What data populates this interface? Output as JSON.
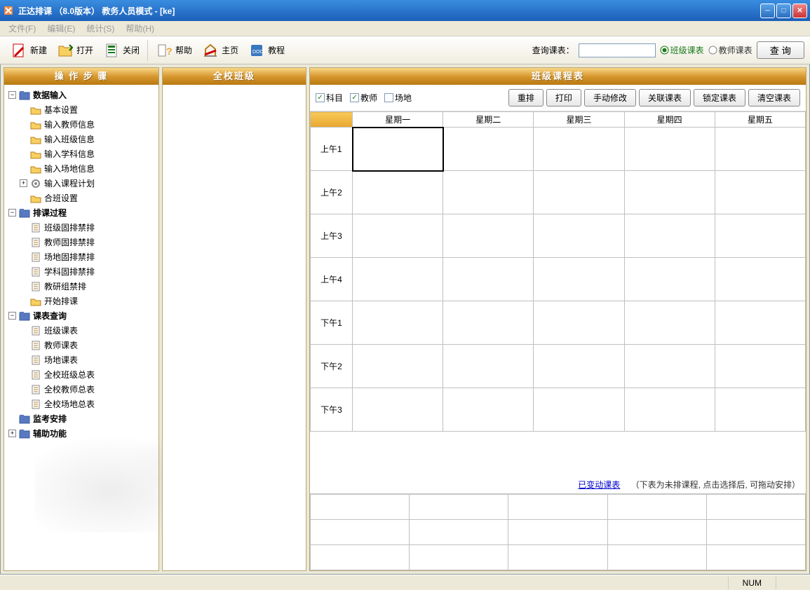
{
  "window": {
    "title": "正达排课 （8.0版本）  教务人员模式 - [ke]"
  },
  "menu": {
    "file": "文件(F)",
    "edit": "编辑(E)",
    "stats": "统计(S)",
    "help": "帮助(H)"
  },
  "toolbar": {
    "new": "新建",
    "open": "打开",
    "close": "关闭",
    "help": "帮助",
    "home": "主页",
    "tutorial": "教程"
  },
  "query": {
    "label": "查询课表：",
    "radio_class": "班级课表",
    "radio_teacher": "教师课表",
    "btn": "查 询"
  },
  "panels": {
    "left": "操 作 步 骤",
    "mid": "全校班级",
    "right": "班级课程表"
  },
  "tree": {
    "g1": "数据输入",
    "g1_1": "基本设置",
    "g1_2": "输入教师信息",
    "g1_3": "输入班级信息",
    "g1_4": "输入学科信息",
    "g1_5": "输入场地信息",
    "g1_6": "输入课程计划",
    "g1_7": "合班设置",
    "g2": "排课过程",
    "g2_1": "班级固排禁排",
    "g2_2": "教师固排禁排",
    "g2_3": "场地固排禁排",
    "g2_4": "学科固排禁排",
    "g2_5": "教研组禁排",
    "g2_6": "开始排课",
    "g3": "课表查询",
    "g3_1": "班级课表",
    "g3_2": "教师课表",
    "g3_3": "场地课表",
    "g3_4": "全校班级总表",
    "g3_5": "全校教师总表",
    "g3_6": "全校场地总表",
    "g4": "监考安排",
    "g5": "辅助功能"
  },
  "sched": {
    "chk_subject": "科目",
    "chk_teacher": "教师",
    "chk_place": "场地",
    "btn_rearrange": "重排",
    "btn_print": "打印",
    "btn_manual": "手动修改",
    "btn_link": "关联课表",
    "btn_lock": "锁定课表",
    "btn_clear": "清空课表",
    "days": [
      "星期一",
      "星期二",
      "星期三",
      "星期四",
      "星期五"
    ],
    "periods": [
      "上午1",
      "上午2",
      "上午3",
      "上午4",
      "下午1",
      "下午2",
      "下午3"
    ]
  },
  "hint": {
    "link": "已变动课表",
    "text": "（下表为未排课程, 点击选择后, 可拖动安排）"
  },
  "status": {
    "num": "NUM"
  }
}
